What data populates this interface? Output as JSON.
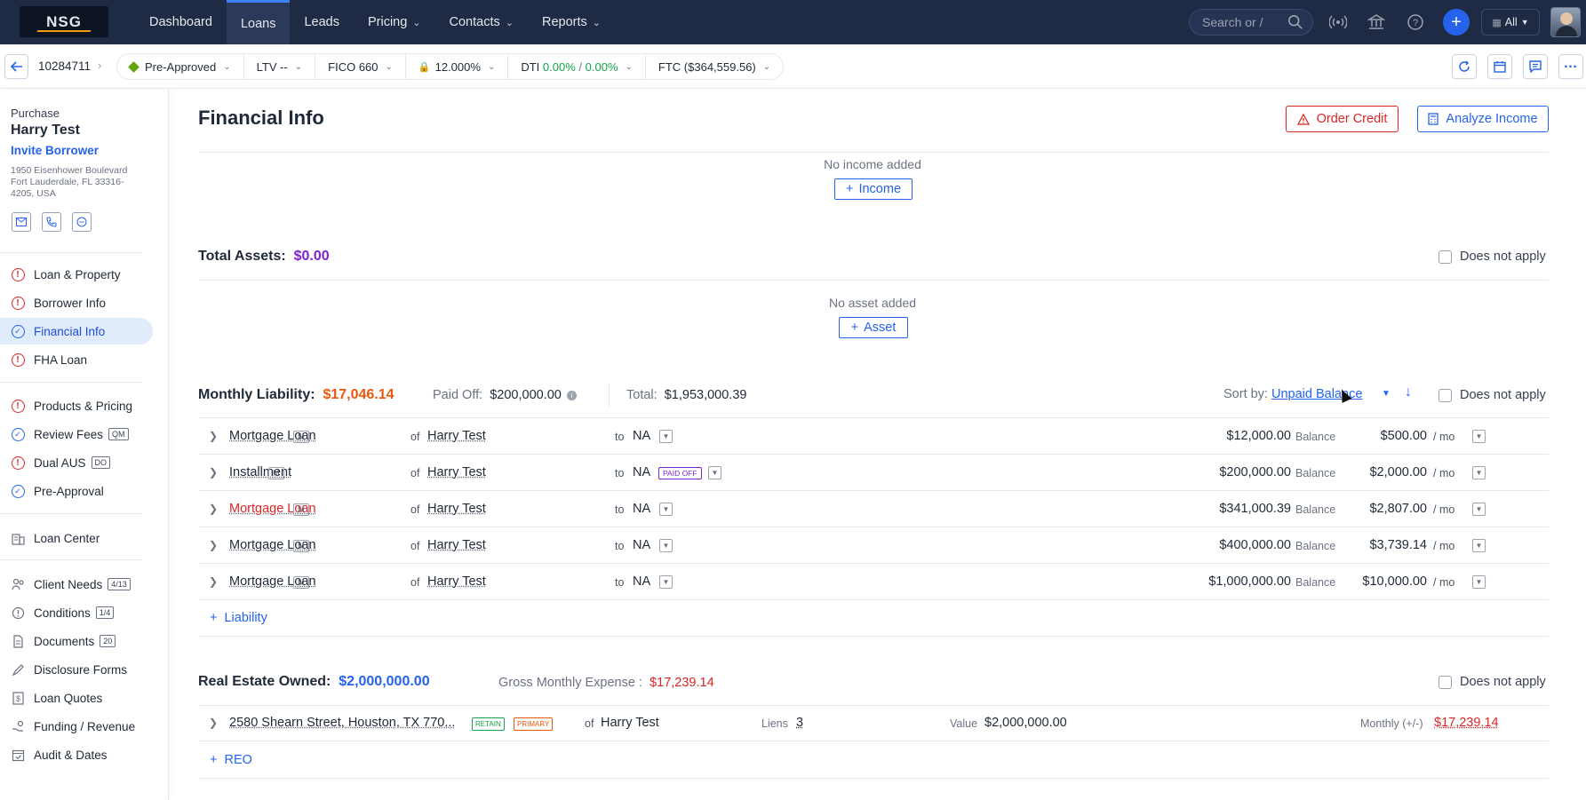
{
  "app": {
    "logo_text": "NSG"
  },
  "topnav": {
    "items": [
      {
        "label": "Dashboard",
        "dropdown": false
      },
      {
        "label": "Loans",
        "dropdown": false,
        "active": true
      },
      {
        "label": "Leads",
        "dropdown": false
      },
      {
        "label": "Pricing",
        "dropdown": true
      },
      {
        "label": "Contacts",
        "dropdown": true
      },
      {
        "label": "Reports",
        "dropdown": true
      }
    ],
    "search_placeholder": "Search or /",
    "scope_label": "All"
  },
  "subbar": {
    "loan_number": "10284711",
    "status": "Pre-Approved",
    "ltv": "LTV --",
    "fico": "FICO 660",
    "rate": "12.000%",
    "dti_label": "DTI",
    "dti_front": "0.00%",
    "dti_sep": "/",
    "dti_back": "0.00%",
    "ftc": "FTC ($364,559.56)"
  },
  "sidebar": {
    "loan_type": "Purchase",
    "borrower_name": "Harry Test",
    "invite_label": "Invite Borrower",
    "address": "1950 Eisenhower Boulevard Fort Lauderdale, FL 33316-4205, USA",
    "group1": [
      {
        "label": "Loan & Property",
        "status": "warning"
      },
      {
        "label": "Borrower Info",
        "status": "warning"
      },
      {
        "label": "Financial Info",
        "status": "done",
        "active": true
      },
      {
        "label": "FHA Loan",
        "status": "warning"
      }
    ],
    "group2": [
      {
        "label": "Products & Pricing",
        "status": "warning",
        "badge": ""
      },
      {
        "label": "Review Fees",
        "status": "done",
        "badge": "QM"
      },
      {
        "label": "Dual AUS",
        "status": "warning",
        "badge": "DO"
      },
      {
        "label": "Pre-Approval",
        "status": "done",
        "badge": ""
      }
    ],
    "group3": [
      {
        "label": "Loan Center",
        "icon": "building-icon"
      }
    ],
    "group4": [
      {
        "label": "Client Needs",
        "icon": "people-icon",
        "badge": "4/13"
      },
      {
        "label": "Conditions",
        "icon": "alert-icon",
        "badge": "1/4"
      },
      {
        "label": "Documents",
        "icon": "document-icon",
        "badge": "20"
      },
      {
        "label": "Disclosure Forms",
        "icon": "pen-icon",
        "badge": ""
      },
      {
        "label": "Loan Quotes",
        "icon": "dollar-icon",
        "badge": ""
      },
      {
        "label": "Funding / Revenue",
        "icon": "hand-coin-icon",
        "badge": ""
      },
      {
        "label": "Audit & Dates",
        "icon": "calendar-check-icon",
        "badge": ""
      }
    ]
  },
  "main": {
    "title": "Financial Info",
    "order_credit_label": "Order Credit",
    "analyze_income_label": "Analyze Income",
    "income": {
      "empty_text": "No income added",
      "add_label": "Income"
    },
    "assets": {
      "label": "Total Assets:",
      "amount": "$0.00",
      "does_not_apply": "Does not apply",
      "empty_text": "No asset added",
      "add_label": "Asset"
    },
    "liability": {
      "label": "Monthly Liability:",
      "amount": "$17,046.14",
      "paid_off_label": "Paid Off:",
      "paid_off_value": "$200,000.00",
      "total_label": "Total:",
      "total_value": "$1,953,000.39",
      "sort_label": "Sort by:",
      "sort_value": "Unpaid Balance",
      "does_not_apply": "Does not apply",
      "of_label": "of",
      "to_label": "to",
      "balance_label": "Balance",
      "per_mo_label": "/ mo",
      "rows": [
        {
          "type": "Mortgage Loan",
          "badge": "M",
          "borrower": "Harry Test",
          "to": "NA",
          "paid_off": "",
          "balance": "$12,000.00",
          "monthly": "$500.00",
          "red": false
        },
        {
          "type": "Installment",
          "badge": "M",
          "borrower": "Harry Test",
          "to": "NA",
          "paid_off": "PAID OFF",
          "balance": "$200,000.00",
          "monthly": "$2,000.00",
          "red": false
        },
        {
          "type": "Mortgage Loan",
          "badge": "M",
          "borrower": "Harry Test",
          "to": "NA",
          "paid_off": "",
          "balance": "$341,000.39",
          "monthly": "$2,807.00",
          "red": true
        },
        {
          "type": "Mortgage Loan",
          "badge": "M",
          "borrower": "Harry Test",
          "to": "NA",
          "paid_off": "",
          "balance": "$400,000.00",
          "monthly": "$3,739.14",
          "red": false
        },
        {
          "type": "Mortgage Loan",
          "badge": "M",
          "borrower": "Harry Test",
          "to": "NA",
          "paid_off": "",
          "balance": "$1,000,000.00",
          "monthly": "$10,000.00",
          "red": false
        }
      ],
      "add_label": "Liability"
    },
    "reo": {
      "label": "Real Estate Owned:",
      "amount": "$2,000,000.00",
      "gross_label": "Gross Monthly Expense :",
      "gross_value": "$17,239.14",
      "does_not_apply": "Does not apply",
      "row": {
        "address": "2580 Shearn Street, Houston, TX 770...",
        "tag_retain": "RETAIN",
        "tag_primary": "PRIMARY",
        "of_label": "of",
        "owner": "Harry Test",
        "liens_label": "Liens",
        "liens_value": "3",
        "value_label": "Value",
        "value": "$2,000,000.00",
        "monthly_label": "Monthly (+/-)",
        "monthly_value": "$17,239.14"
      },
      "add_label": "REO"
    }
  },
  "colors": {
    "nav_bg": "#1f2a44",
    "accent": "#2563eb",
    "danger": "#dc2626",
    "warning_orange": "#ea580c",
    "purple": "#7e22ce",
    "success": "#16a34a"
  }
}
